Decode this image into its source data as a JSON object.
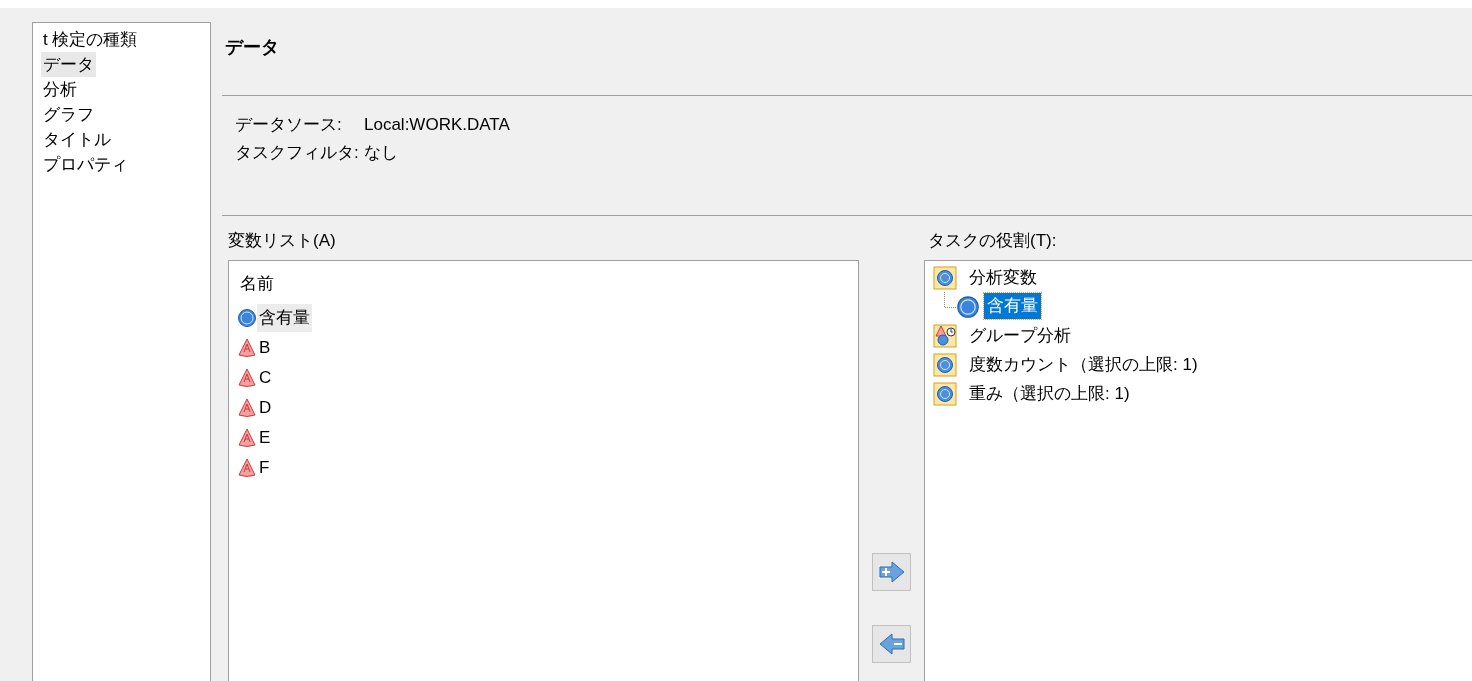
{
  "nav": {
    "items": [
      {
        "label": "t 検定の種類",
        "selected": false
      },
      {
        "label": "データ",
        "selected": true
      },
      {
        "label": "分析",
        "selected": false
      },
      {
        "label": "グラフ",
        "selected": false
      },
      {
        "label": "タイトル",
        "selected": false
      },
      {
        "label": "プロパティ",
        "selected": false
      }
    ]
  },
  "header": {
    "title": "データ"
  },
  "info": [
    {
      "label": "データソース:",
      "value": "Local:WORK.DATA"
    },
    {
      "label": "タスクフィルタ:",
      "value": "なし"
    }
  ],
  "variables": {
    "label": "変数リスト(A)",
    "column": "名前",
    "items": [
      {
        "name": "含有量",
        "kind": "numeric",
        "selected": true
      },
      {
        "name": "B",
        "kind": "character",
        "selected": false
      },
      {
        "name": "C",
        "kind": "character",
        "selected": false
      },
      {
        "name": "D",
        "kind": "character",
        "selected": false
      },
      {
        "name": "E",
        "kind": "character",
        "selected": false
      },
      {
        "name": "F",
        "kind": "character",
        "selected": false
      }
    ]
  },
  "roles": {
    "label": "タスクの役割(T):",
    "items": [
      {
        "label": "分析変数",
        "kind": "numeric",
        "children": [
          {
            "name": "含有量",
            "selected": true
          }
        ]
      },
      {
        "label": "グループ分析",
        "kind": "group"
      },
      {
        "label": "度数カウント（選択の上限: 1)",
        "kind": "numeric"
      },
      {
        "label": "重み（選択の上限: 1)",
        "kind": "numeric"
      }
    ]
  }
}
